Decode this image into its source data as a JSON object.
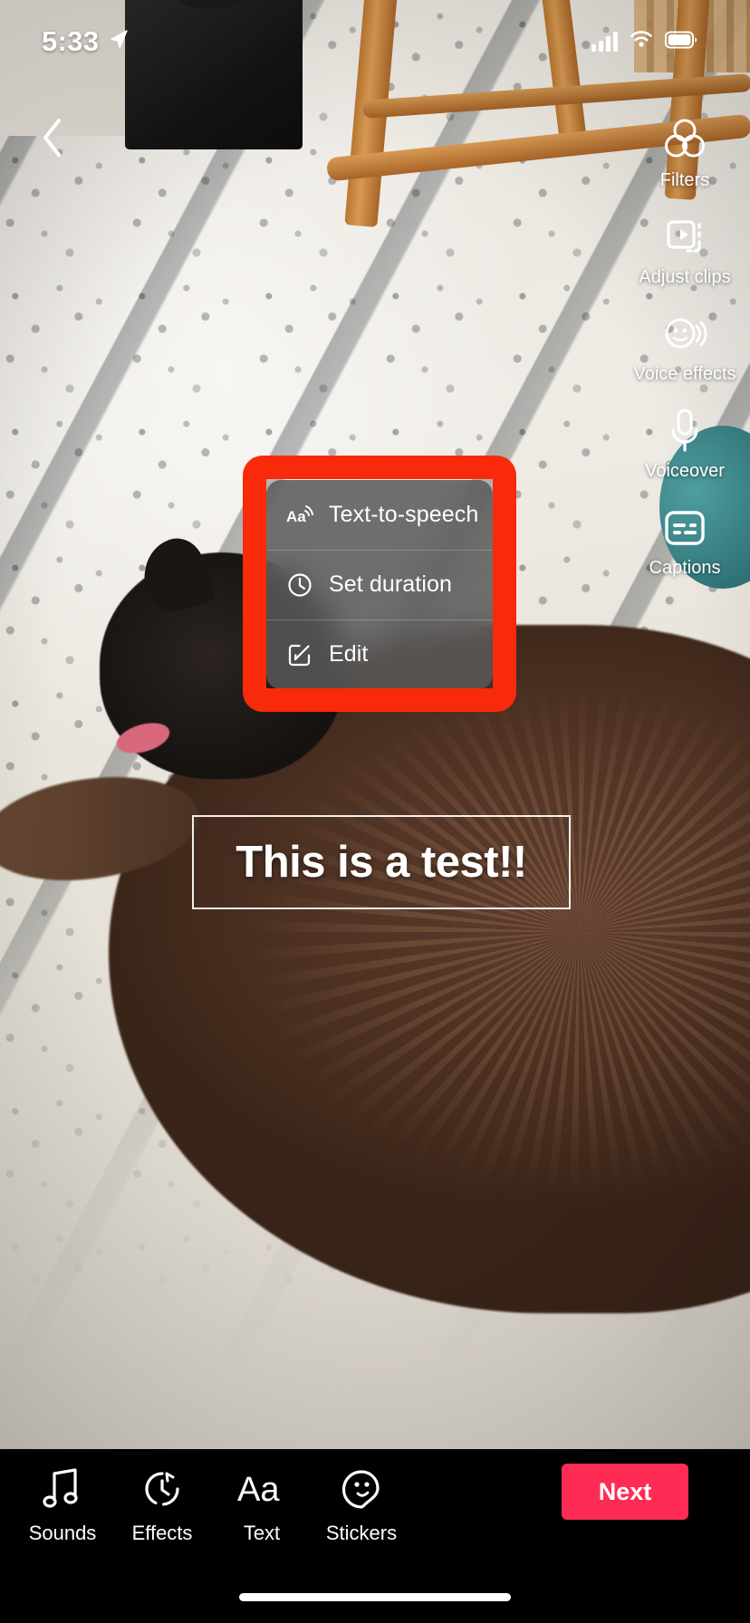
{
  "status_bar": {
    "time": "5:33",
    "location_icon": "location-arrow-icon",
    "signal_icon": "cellular-signal-icon",
    "wifi_icon": "wifi-icon",
    "battery_icon": "battery-icon"
  },
  "nav": {
    "back_icon": "chevron-left-icon"
  },
  "right_rail": {
    "items": [
      {
        "label": "Filters",
        "icon": "filters-icon"
      },
      {
        "label": "Adjust clips",
        "icon": "adjust-clips-icon"
      },
      {
        "label": "Voice effects",
        "icon": "voice-effects-icon"
      },
      {
        "label": "Voiceover",
        "icon": "microphone-icon"
      },
      {
        "label": "Captions",
        "icon": "captions-icon"
      }
    ]
  },
  "context_menu": {
    "items": [
      {
        "label": "Text-to-speech",
        "icon": "text-to-speech-icon"
      },
      {
        "label": "Set duration",
        "icon": "clock-icon"
      },
      {
        "label": "Edit",
        "icon": "pencil-square-icon"
      }
    ]
  },
  "highlight": {
    "color": "#F92A0C"
  },
  "text_overlay": {
    "value": "This is a test!!"
  },
  "bottom_bar": {
    "tools": [
      {
        "label": "Sounds",
        "icon": "music-note-icon"
      },
      {
        "label": "Effects",
        "icon": "effects-timer-icon"
      },
      {
        "label": "Text",
        "icon": "text-aa-icon"
      },
      {
        "label": "Stickers",
        "icon": "sticker-ghost-icon"
      }
    ],
    "next_label": "Next",
    "next_color": "#FE2C55"
  }
}
